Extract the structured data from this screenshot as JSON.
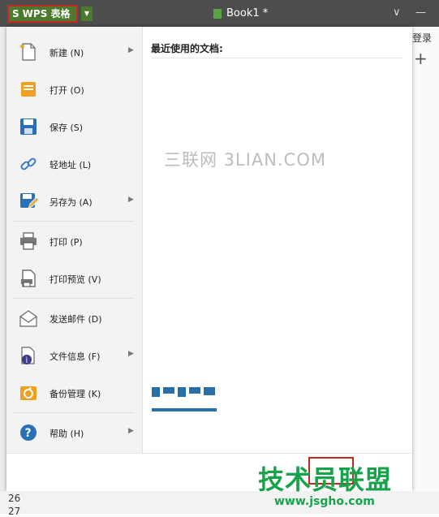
{
  "titlebar": {
    "app_logo": "S",
    "app_name": "WPS 表格",
    "doc_title": "Book1 *",
    "min_icon": "—",
    "collapse_icon": "∨"
  },
  "sheet": {
    "login": "登录",
    "add_tab": "+",
    "rows_bottom": [
      "26",
      "27"
    ]
  },
  "menu": {
    "items": [
      {
        "label": "新建 (N)",
        "icon": "new-file-icon",
        "has_submenu": true
      },
      {
        "label": "打开 (O)",
        "icon": "open-folder-icon",
        "has_submenu": false
      },
      {
        "label": "保存 (S)",
        "icon": "save-icon",
        "has_submenu": false
      },
      {
        "label": "轻地址 (L)",
        "icon": "link-icon",
        "has_submenu": false
      },
      {
        "label": "另存为 (A)",
        "icon": "save-as-icon",
        "has_submenu": true
      },
      {
        "label": "打印 (P)",
        "icon": "printer-icon",
        "has_submenu": false
      },
      {
        "label": "打印预览 (V)",
        "icon": "print-preview-icon",
        "has_submenu": false
      },
      {
        "label": "发送邮件 (D)",
        "icon": "mail-icon",
        "has_submenu": false
      },
      {
        "label": "文件信息 (F)",
        "icon": "file-info-icon",
        "has_submenu": true
      },
      {
        "label": "备份管理 (K)",
        "icon": "backup-icon",
        "has_submenu": false
      },
      {
        "label": "帮助 (H)",
        "icon": "help-icon",
        "has_submenu": true
      }
    ],
    "recent_title": "最近使用的文档:",
    "watermark": "三联网 3LIAN.COM"
  },
  "overlay": {
    "brand": "技术员联盟",
    "url": "www.jsgho.com"
  },
  "colors": {
    "titlebar": "#4d4d4d",
    "app_green": "#4c7a2c",
    "highlight_red": "#c22a1f",
    "brand_green": "#16a34a"
  }
}
